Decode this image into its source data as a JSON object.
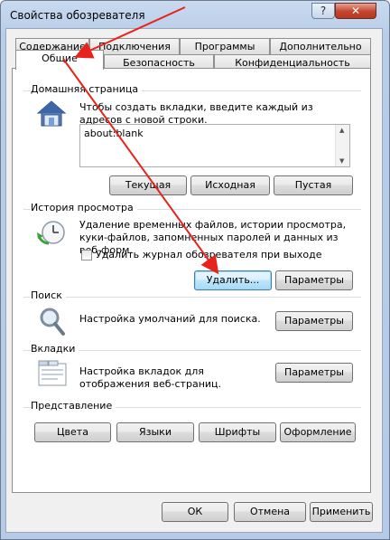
{
  "window": {
    "title": "Свойства обозревателя"
  },
  "titlebar": {
    "help": "?",
    "close": "✕"
  },
  "tabs": {
    "row_back": [
      "Содержание",
      "Подключения",
      "Программы",
      "Дополнительно"
    ],
    "row_front": [
      "Общие",
      "Безопасность",
      "Конфиденциальность"
    ],
    "active": "Общие"
  },
  "home": {
    "title": "Домашняя страница",
    "description": "Чтобы создать вкладки, введите каждый из адресов с новой строки.",
    "url": "about:blank",
    "buttons": {
      "current": "Текущая",
      "default": "Исходная",
      "blank": "Пустая"
    }
  },
  "history": {
    "title": "История просмотра",
    "description": "Удаление временных файлов, истории просмотра, куки-файлов, запомненных паролей и данных из веб-форм.",
    "checkbox_label": "Удалить журнал обозревателя при выходе",
    "checkbox_checked": false,
    "buttons": {
      "delete": "Удалить...",
      "settings": "Параметры"
    }
  },
  "search": {
    "title": "Поиск",
    "description": "Настройка умолчаний для поиска.",
    "button": "Параметры"
  },
  "tabs_group": {
    "title": "Вкладки",
    "description": "Настройка вкладок для отображения веб-страниц.",
    "button": "Параметры"
  },
  "appearance": {
    "title": "Представление",
    "buttons": {
      "colors": "Цвета",
      "languages": "Языки",
      "fonts": "Шрифты",
      "accessibility": "Оформление"
    }
  },
  "footer": {
    "ok": "ОК",
    "cancel": "Отмена",
    "apply": "Применить"
  },
  "colors": {
    "annotation_arrow": "#e8231c",
    "focus_border": "#3c7fb1",
    "link_blue": "#1f5fa8"
  },
  "icons": {
    "home": "house-icon",
    "history": "clock-arrow-icon",
    "search": "magnifier-icon",
    "tabs": "tabs-window-icon"
  }
}
